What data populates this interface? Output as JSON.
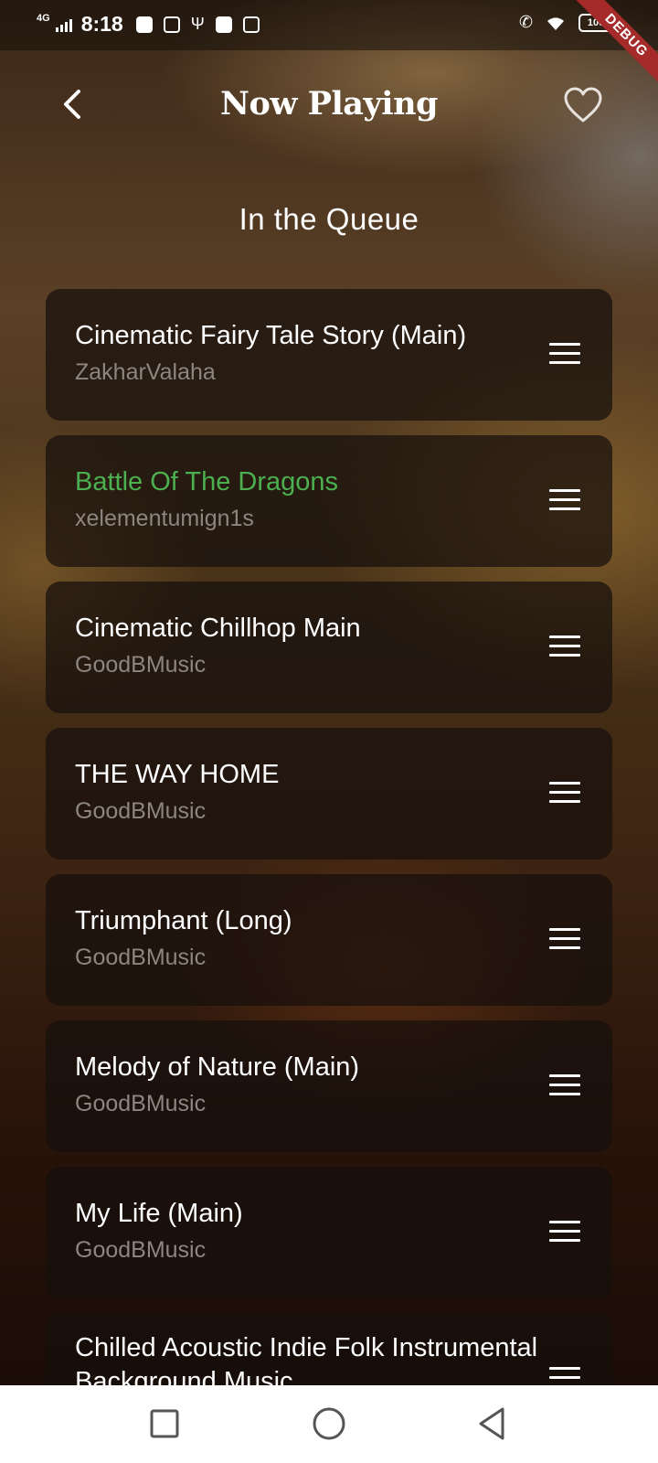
{
  "status_bar": {
    "network": "4G",
    "time": "8:18",
    "battery": "100",
    "debug_banner": "DEBUG"
  },
  "header": {
    "title": "Now Playing",
    "back_icon": "chevron-left-icon",
    "favorite_icon": "heart-outline-icon"
  },
  "queue": {
    "heading": "In the Queue",
    "items": [
      {
        "title": "Cinematic Fairy Tale Story (Main)",
        "artist": "ZakharValaha",
        "playing": false
      },
      {
        "title": "Battle Of The Dragons",
        "artist": "xelementumign1s",
        "playing": true
      },
      {
        "title": "Cinematic Chillhop Main",
        "artist": "GoodBMusic",
        "playing": false
      },
      {
        "title": "THE WAY HOME",
        "artist": "GoodBMusic",
        "playing": false
      },
      {
        "title": "Triumphant (Long)",
        "artist": "GoodBMusic",
        "playing": false
      },
      {
        "title": "Melody of Nature (Main)",
        "artist": "GoodBMusic",
        "playing": false
      },
      {
        "title": "My Life (Main)",
        "artist": "GoodBMusic",
        "playing": false
      },
      {
        "title": "Chilled Acoustic Indie Folk Instrumental Background Music",
        "artist": "",
        "playing": false
      }
    ]
  },
  "colors": {
    "playing_title": "#4caf50",
    "artist_text": "#8c8580",
    "card_background": "#160f0c"
  },
  "nav_bar": {
    "recents_icon": "square-icon",
    "home_icon": "circle-icon",
    "back_icon": "triangle-back-icon"
  }
}
